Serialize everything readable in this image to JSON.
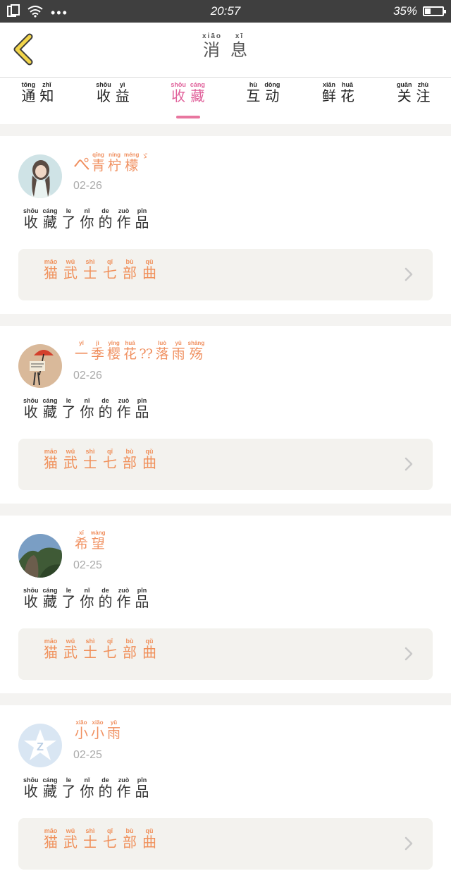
{
  "status_bar": {
    "time": "20:57",
    "battery": "35%",
    "battery_level": 0.35
  },
  "header": {
    "title": [
      {
        "char": "消",
        "pinyin": "xiāo"
      },
      {
        "char": "息",
        "pinyin": "xī"
      }
    ]
  },
  "tabs": [
    {
      "chars": [
        {
          "char": "通",
          "pinyin": "tōng"
        },
        {
          "char": "知",
          "pinyin": "zhī"
        }
      ],
      "active": false
    },
    {
      "chars": [
        {
          "char": "收",
          "pinyin": "shōu"
        },
        {
          "char": "益",
          "pinyin": "yì"
        }
      ],
      "active": false
    },
    {
      "chars": [
        {
          "char": "收",
          "pinyin": "shōu"
        },
        {
          "char": "藏",
          "pinyin": "cáng"
        }
      ],
      "active": true
    },
    {
      "chars": [
        {
          "char": "互",
          "pinyin": "hù"
        },
        {
          "char": "动",
          "pinyin": "dòng"
        }
      ],
      "active": false
    },
    {
      "chars": [
        {
          "char": "鲜",
          "pinyin": "xiān"
        },
        {
          "char": "花",
          "pinyin": "huā"
        }
      ],
      "active": false
    },
    {
      "chars": [
        {
          "char": "关",
          "pinyin": "guān"
        },
        {
          "char": "注",
          "pinyin": "zhù"
        }
      ],
      "active": false
    }
  ],
  "messages": [
    {
      "avatar": "girl-photo-avatar",
      "user_prefix": "ぺ",
      "user": [
        {
          "char": "青",
          "pinyin": "qīng"
        },
        {
          "char": "柠",
          "pinyin": "níng"
        },
        {
          "char": "檬",
          "pinyin": "méng"
        }
      ],
      "user_suffix": "ゞ",
      "date": "02-26",
      "action": [
        {
          "char": "收",
          "pinyin": "shōu"
        },
        {
          "char": "藏",
          "pinyin": "cáng"
        },
        {
          "char": "了",
          "pinyin": "le"
        },
        {
          "char": "你",
          "pinyin": "nǐ"
        },
        {
          "char": "的",
          "pinyin": "de"
        },
        {
          "char": "作",
          "pinyin": "zuò"
        },
        {
          "char": "品",
          "pinyin": "pǐn"
        }
      ],
      "work": [
        {
          "char": "猫",
          "pinyin": "māo"
        },
        {
          "char": "武",
          "pinyin": "wǔ"
        },
        {
          "char": "士",
          "pinyin": "shì"
        },
        {
          "char": "七",
          "pinyin": "qī"
        },
        {
          "char": "部",
          "pinyin": "bù"
        },
        {
          "char": "曲",
          "pinyin": "qǔ"
        }
      ]
    },
    {
      "avatar": "umbrella-drawing-avatar",
      "user_prefix": "",
      "user": [
        {
          "char": "一",
          "pinyin": "yī"
        },
        {
          "char": "季",
          "pinyin": "jì"
        },
        {
          "char": "樱",
          "pinyin": "yīng"
        },
        {
          "char": "花",
          "pinyin": "huā"
        },
        {
          "char": "⁇",
          "pinyin": ""
        },
        {
          "char": "落",
          "pinyin": "luò"
        },
        {
          "char": "雨",
          "pinyin": "yǔ"
        },
        {
          "char": "殇",
          "pinyin": "shāng"
        }
      ],
      "user_suffix": "",
      "date": "02-26",
      "action": [
        {
          "char": "收",
          "pinyin": "shōu"
        },
        {
          "char": "藏",
          "pinyin": "cáng"
        },
        {
          "char": "了",
          "pinyin": "le"
        },
        {
          "char": "你",
          "pinyin": "nǐ"
        },
        {
          "char": "的",
          "pinyin": "de"
        },
        {
          "char": "作",
          "pinyin": "zuò"
        },
        {
          "char": "品",
          "pinyin": "pǐn"
        }
      ],
      "work": [
        {
          "char": "猫",
          "pinyin": "māo"
        },
        {
          "char": "武",
          "pinyin": "wǔ"
        },
        {
          "char": "士",
          "pinyin": "shì"
        },
        {
          "char": "七",
          "pinyin": "qī"
        },
        {
          "char": "部",
          "pinyin": "bù"
        },
        {
          "char": "曲",
          "pinyin": "qǔ"
        }
      ]
    },
    {
      "avatar": "landscape-photo-avatar",
      "user_prefix": "",
      "user": [
        {
          "char": "希",
          "pinyin": "xī"
        },
        {
          "char": "望",
          "pinyin": "wàng"
        }
      ],
      "user_suffix": "",
      "date": "02-25",
      "action": [
        {
          "char": "收",
          "pinyin": "shōu"
        },
        {
          "char": "藏",
          "pinyin": "cáng"
        },
        {
          "char": "了",
          "pinyin": "le"
        },
        {
          "char": "你",
          "pinyin": "nǐ"
        },
        {
          "char": "的",
          "pinyin": "de"
        },
        {
          "char": "作",
          "pinyin": "zuò"
        },
        {
          "char": "品",
          "pinyin": "pǐn"
        }
      ],
      "work": [
        {
          "char": "猫",
          "pinyin": "māo"
        },
        {
          "char": "武",
          "pinyin": "wǔ"
        },
        {
          "char": "士",
          "pinyin": "shì"
        },
        {
          "char": "七",
          "pinyin": "qī"
        },
        {
          "char": "部",
          "pinyin": "bù"
        },
        {
          "char": "曲",
          "pinyin": "qǔ"
        }
      ]
    },
    {
      "avatar": "default-z-avatar",
      "user_prefix": "",
      "user": [
        {
          "char": "小",
          "pinyin": "xiǎo"
        },
        {
          "char": "小",
          "pinyin": "xiǎo"
        },
        {
          "char": "雨",
          "pinyin": "yǔ"
        }
      ],
      "user_suffix": "",
      "date": "02-25",
      "action": [
        {
          "char": "收",
          "pinyin": "shōu"
        },
        {
          "char": "藏",
          "pinyin": "cáng"
        },
        {
          "char": "了",
          "pinyin": "le"
        },
        {
          "char": "你",
          "pinyin": "nǐ"
        },
        {
          "char": "的",
          "pinyin": "de"
        },
        {
          "char": "作",
          "pinyin": "zuò"
        },
        {
          "char": "品",
          "pinyin": "pǐn"
        }
      ],
      "work": [
        {
          "char": "猫",
          "pinyin": "māo"
        },
        {
          "char": "武",
          "pinyin": "wǔ"
        },
        {
          "char": "士",
          "pinyin": "shì"
        },
        {
          "char": "七",
          "pinyin": "qī"
        },
        {
          "char": "部",
          "pinyin": "bù"
        },
        {
          "char": "曲",
          "pinyin": "qǔ"
        }
      ]
    }
  ],
  "colors": {
    "accent_pink": "#e0609a",
    "username_orange": "#f09060",
    "back_arrow_yellow": "#f2d54a"
  }
}
